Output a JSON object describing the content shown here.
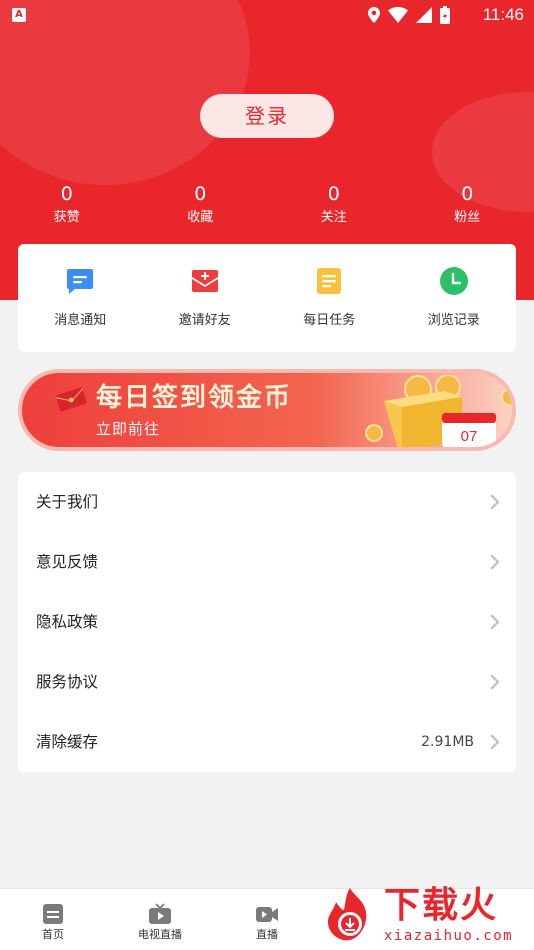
{
  "status_bar": {
    "time": "11:46",
    "left_badge": "A"
  },
  "header": {
    "login_label": "登录",
    "stats": [
      {
        "value": "0",
        "label": "获赞"
      },
      {
        "value": "0",
        "label": "收藏"
      },
      {
        "value": "0",
        "label": "关注"
      },
      {
        "value": "0",
        "label": "粉丝"
      }
    ]
  },
  "actions": [
    {
      "label": "消息通知",
      "icon": "message-icon",
      "color": "#3a8ef6"
    },
    {
      "label": "邀请好友",
      "icon": "invite-envelope-icon",
      "color": "#ee3b3b"
    },
    {
      "label": "每日任务",
      "icon": "task-list-icon",
      "color": "#f9c23c"
    },
    {
      "label": "浏览记录",
      "icon": "clock-history-icon",
      "color": "#2dbf6a"
    }
  ],
  "banner": {
    "title": "每日签到领金币",
    "subtitle": "立即前往",
    "calendar_day": "07"
  },
  "settings": [
    {
      "label": "关于我们",
      "value": ""
    },
    {
      "label": "意见反馈",
      "value": ""
    },
    {
      "label": "隐私政策",
      "value": ""
    },
    {
      "label": "服务协议",
      "value": ""
    },
    {
      "label": "清除缓存",
      "value": "2.91MB"
    }
  ],
  "bottom_nav": [
    {
      "label": "首页",
      "icon": "home-icon"
    },
    {
      "label": "电视直播",
      "icon": "tv-icon"
    },
    {
      "label": "直播",
      "icon": "video-camera-icon"
    }
  ],
  "watermark": {
    "text": "下载火",
    "url": "xiazaihuo.com"
  },
  "colors": {
    "brand_red": "#e8262c",
    "login_bg": "#fde6e6",
    "page_bg": "#f2f2f2"
  }
}
